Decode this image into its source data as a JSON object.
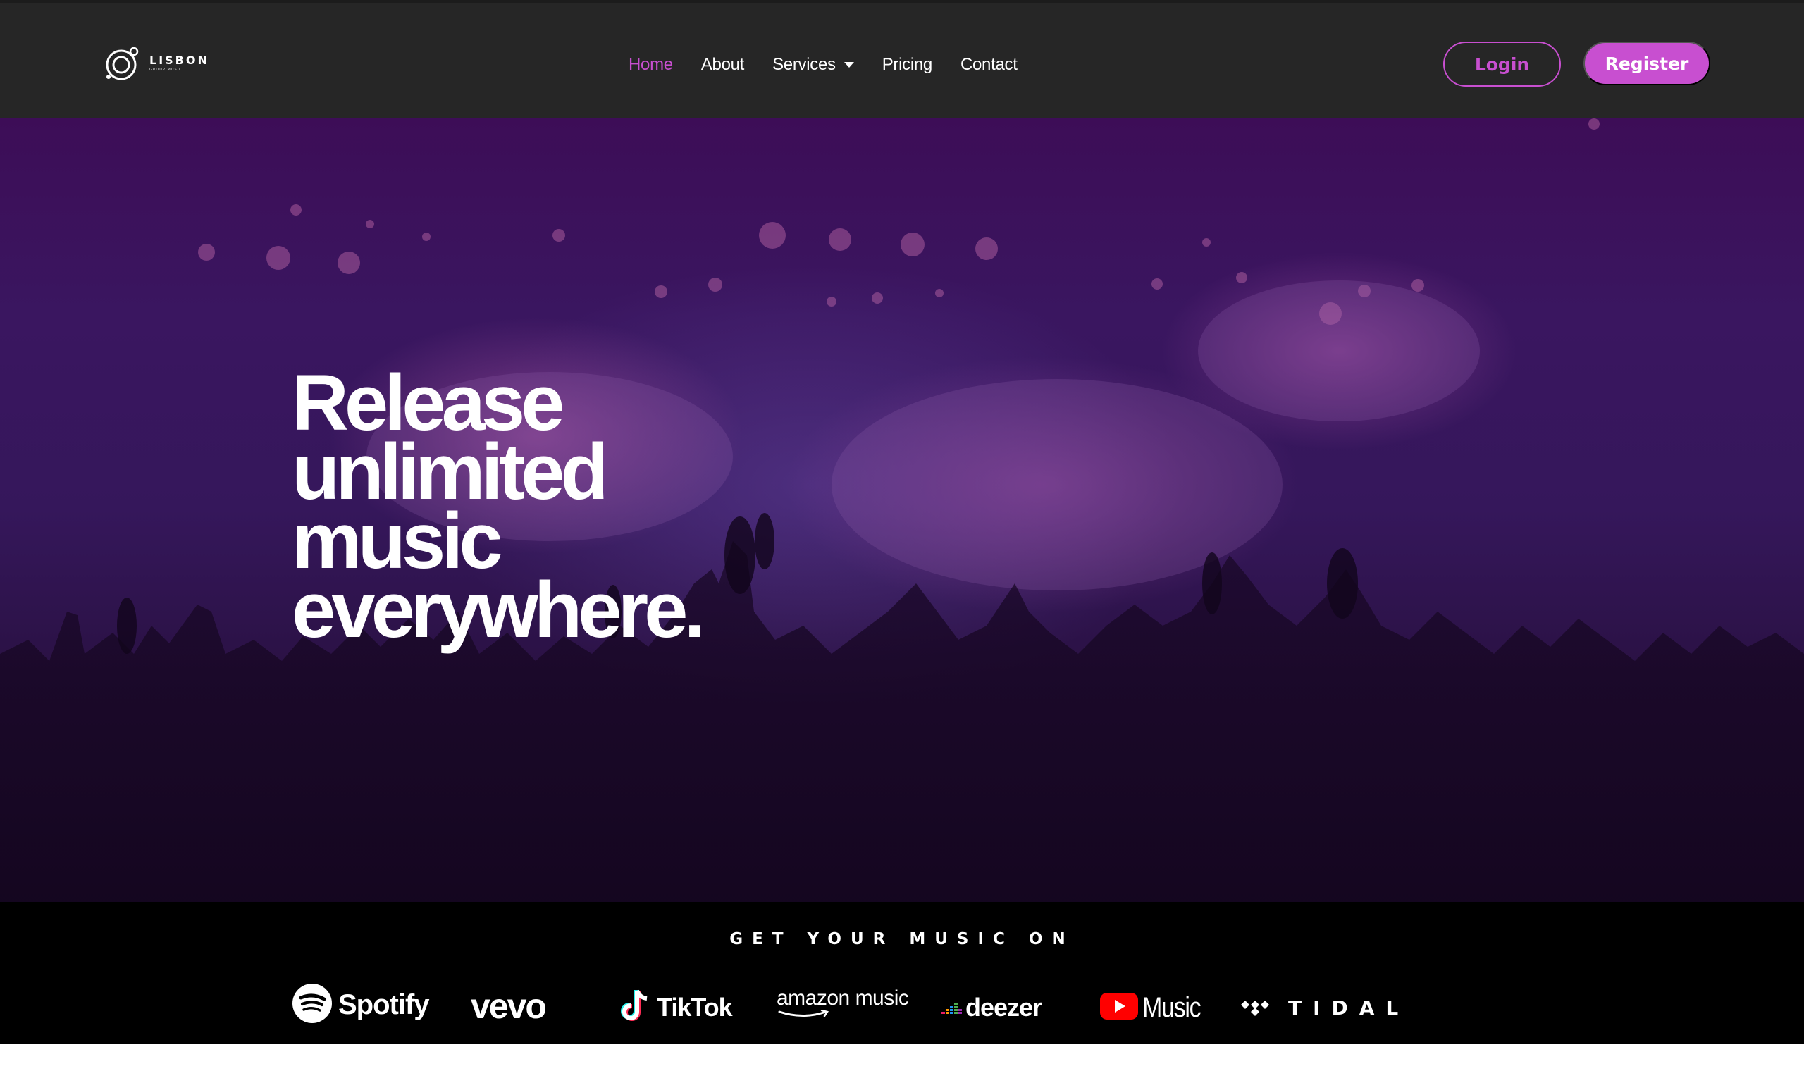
{
  "header": {
    "logo": {
      "name": "LISBON",
      "subtitle": "GROUP MUSIC",
      "icon": "orbit-ring-icon"
    },
    "nav": [
      {
        "label": "Home",
        "active": true
      },
      {
        "label": "About",
        "active": false
      },
      {
        "label": "Services",
        "active": false,
        "dropdown": true
      },
      {
        "label": "Pricing",
        "active": false
      },
      {
        "label": "Contact",
        "active": false
      }
    ],
    "login_label": "Login",
    "register_label": "Register"
  },
  "hero": {
    "headline_lines": [
      "Release",
      "unlimited",
      "music",
      "everywhere."
    ],
    "background": "concert-crowd-purple-photo"
  },
  "platforms": {
    "title": "GET YOUR MUSIC ON",
    "logos": [
      {
        "name": "Spotify",
        "icon": "spotify-icon"
      },
      {
        "name": "vevo",
        "icon": "vevo-wordmark"
      },
      {
        "name": "TikTok",
        "icon": "tiktok-icon"
      },
      {
        "name": "amazon music",
        "icon": "amazon-smile-icon"
      },
      {
        "name": "deezer",
        "icon": "deezer-bars-icon"
      },
      {
        "name": "Music",
        "icon": "youtube-play-icon"
      },
      {
        "name": "TIDAL",
        "icon": "tidal-diamonds-icon"
      }
    ]
  },
  "colors": {
    "accent": "#c84fd0",
    "header_bg": "#262626",
    "hero_purple": "#3a1660",
    "strip_bg": "#000000"
  }
}
